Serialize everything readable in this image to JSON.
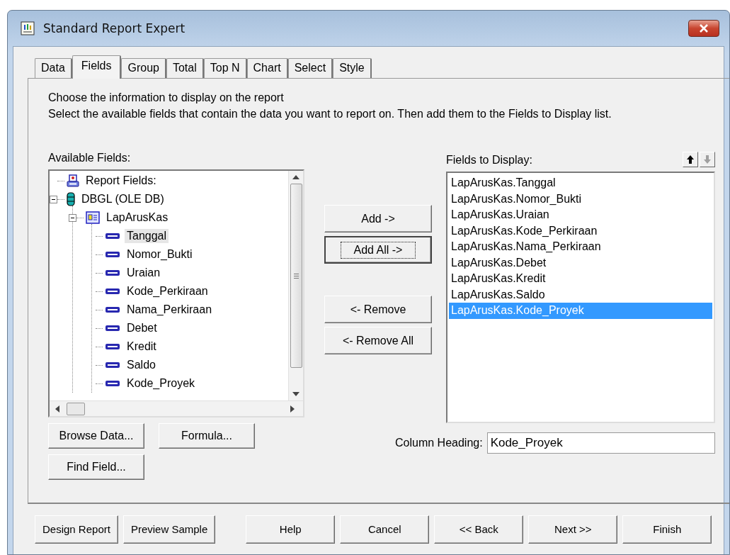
{
  "window": {
    "title": "Standard Report Expert"
  },
  "tabs": [
    {
      "label": "Data",
      "selected": false
    },
    {
      "label": "Fields",
      "selected": true
    },
    {
      "label": "Group",
      "selected": false
    },
    {
      "label": "Total",
      "selected": false
    },
    {
      "label": "Top N",
      "selected": false
    },
    {
      "label": "Chart",
      "selected": false
    },
    {
      "label": "Select",
      "selected": false
    },
    {
      "label": "Style",
      "selected": false
    }
  ],
  "intro": [
    "Choose the information to display on the report",
    "Select the available fields that contain the data you want to report on.  Then add them to the Fields to Display list."
  ],
  "available_fields": {
    "label": "Available Fields:",
    "tree": [
      {
        "kind": "report",
        "label": "Report Fields:",
        "selected": false
      },
      {
        "kind": "database",
        "label": "DBGL (OLE DB)",
        "selected": false,
        "expanded": true,
        "children": [
          {
            "kind": "table",
            "label": "LapArusKas",
            "selected": false,
            "expanded": true,
            "children": [
              {
                "kind": "field",
                "label": "Tanggal",
                "selected": true
              },
              {
                "kind": "field",
                "label": "Nomor_Bukti",
                "selected": false
              },
              {
                "kind": "field",
                "label": "Uraian",
                "selected": false
              },
              {
                "kind": "field",
                "label": "Kode_Perkiraan",
                "selected": false
              },
              {
                "kind": "field",
                "label": "Nama_Perkiraan",
                "selected": false
              },
              {
                "kind": "field",
                "label": "Debet",
                "selected": false
              },
              {
                "kind": "field",
                "label": "Kredit",
                "selected": false
              },
              {
                "kind": "field",
                "label": "Saldo",
                "selected": false
              },
              {
                "kind": "field",
                "label": "Kode_Proyek",
                "selected": false
              }
            ]
          }
        ]
      }
    ],
    "buttons": [
      "Browse Data...",
      "Formula...",
      "Find Field..."
    ]
  },
  "move_buttons": [
    {
      "label": "Add ->",
      "default": false
    },
    {
      "label": "Add All ->",
      "default": true
    },
    {
      "label": "<- Remove",
      "default": false
    },
    {
      "label": "<- Remove All",
      "default": false
    }
  ],
  "fields_to_display": {
    "label": "Fields to Display:",
    "move_up": {
      "disabled": false
    },
    "move_down": {
      "disabled": true
    },
    "items": [
      {
        "label": "LapArusKas.Tanggal",
        "selected": false
      },
      {
        "label": "LapArusKas.Nomor_Bukti",
        "selected": false
      },
      {
        "label": "LapArusKas.Uraian",
        "selected": false
      },
      {
        "label": "LapArusKas.Kode_Perkiraan",
        "selected": false
      },
      {
        "label": "LapArusKas.Nama_Perkiraan",
        "selected": false
      },
      {
        "label": "LapArusKas.Debet",
        "selected": false
      },
      {
        "label": "LapArusKas.Kredit",
        "selected": false
      },
      {
        "label": "LapArusKas.Saldo",
        "selected": false
      },
      {
        "label": "LapArusKas.Kode_Proyek",
        "selected": true
      }
    ],
    "column_heading": {
      "label": "Column Heading:",
      "value": "Kode_Proyek"
    }
  },
  "footer_buttons": [
    "Design Report",
    "Preview Sample",
    "Help",
    "Cancel",
    "<< Back",
    "Next >>",
    "Finish"
  ]
}
